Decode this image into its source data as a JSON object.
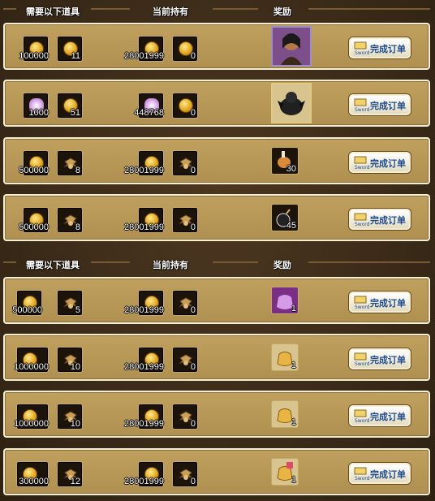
{
  "headers": {
    "need": "需要以下道具",
    "have": "当前持有",
    "reward": "奖励"
  },
  "button": {
    "label": "完成订单",
    "sub": "Sword"
  },
  "section1": [
    {
      "need_a": "100000",
      "need_b": "11",
      "have_a": "28001999",
      "have_b": "0",
      "reward_count": "",
      "reward_icon": "hero-portrait-icon"
    },
    {
      "need_a": "1000",
      "need_b": "51",
      "have_a": "448768",
      "have_b": "0",
      "reward_count": "",
      "reward_icon": "dark-beast-icon"
    },
    {
      "need_a": "500000",
      "need_b": "8",
      "have_a": "28001999",
      "have_b": "0",
      "reward_count": "30",
      "reward_icon": "meat-icon"
    },
    {
      "need_a": "500000",
      "need_b": "8",
      "have_a": "28001999",
      "have_b": "0",
      "reward_count": "45",
      "reward_icon": "bomb-icon"
    }
  ],
  "section2": [
    {
      "need_a": "500000",
      "need_b": "5",
      "have_a": "28001999",
      "have_b": "0",
      "reward_count": "1",
      "reward_icon": "purple-pouch-icon"
    },
    {
      "need_a": "1000000",
      "need_b": "10",
      "have_a": "28001999",
      "have_b": "0",
      "reward_count": "1",
      "reward_icon": "gold-sack-icon"
    },
    {
      "need_a": "1000000",
      "need_b": "10",
      "have_a": "28001999",
      "have_b": "0",
      "reward_count": "1",
      "reward_icon": "gold-sack-icon"
    },
    {
      "need_a": "300000",
      "need_b": "12",
      "have_a": "28001999",
      "have_b": "0",
      "reward_count": "1",
      "reward_icon": "special-sack-icon"
    }
  ]
}
